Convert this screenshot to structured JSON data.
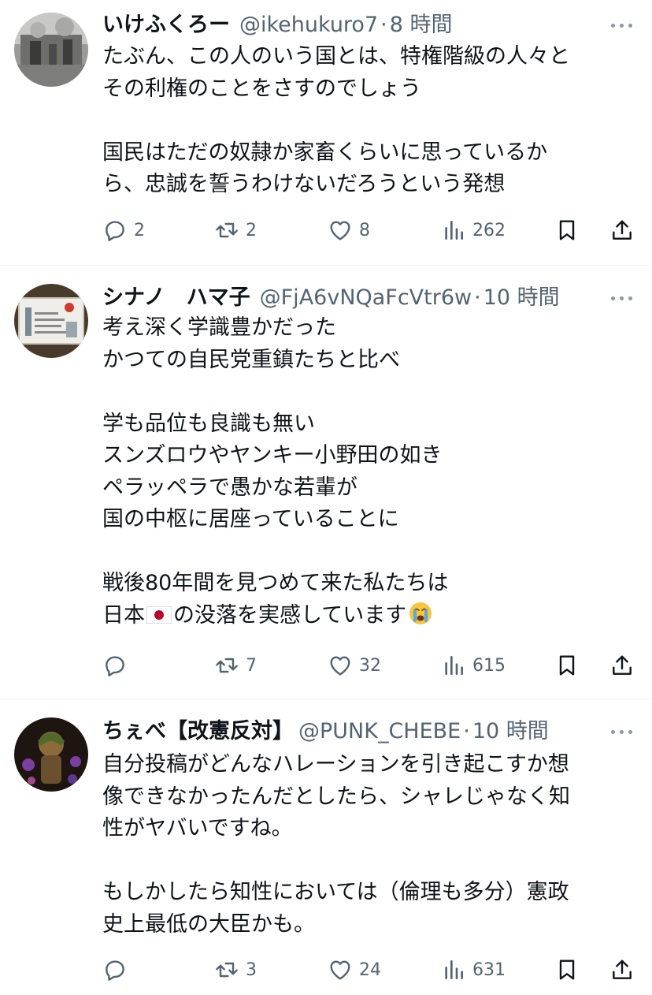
{
  "posts": [
    {
      "name": "いけふくろー",
      "handle": "@ikehukuro7",
      "separator": "·",
      "time": "8 時間",
      "lines": [
        "たぶん、この人のいう国とは、特権階級の人々と",
        "その利権のことをさすのでしょう",
        "",
        "国民はただの奴隷か家畜くらいに思っているか",
        "ら、忠誠を誓うわけないだろうという発想"
      ],
      "replies": "2",
      "reposts": "2",
      "likes": "8",
      "views": "262"
    },
    {
      "name": "シナノ　ハマ子",
      "handle": "@FjA6vNQaFcVtr6w",
      "separator": "·",
      "time": "10 時間",
      "lines": [
        "考え深く学識豊かだった",
        "かつての自民党重鎮たちと比べ",
        "",
        "学も品位も良識も無い",
        "スンズロウやヤンキー小野田の如き",
        "ペラッペラで愚かな若輩が",
        "国の中枢に居座っていることに",
        "",
        "戦後80年間を見つめて来た私たちは"
      ],
      "last_line_pre": "日本",
      "last_line_post": "の没落を実感しています",
      "replies": "",
      "reposts": "7",
      "likes": "32",
      "views": "615"
    },
    {
      "name": "ちぇべ【改憲反対】",
      "handle": "@PUNK_CHEBE",
      "separator": "·",
      "time": "10 時間",
      "lines": [
        "自分投稿がどんなハレーションを引き起こすか想",
        "像できなかったんだとしたら、シャレじゃなく知",
        "性がヤバいですね。",
        "",
        "もしかしたら知性においては（倫理も多分）憲政",
        "史上最低の大臣かも。"
      ],
      "replies": "",
      "reposts": "3",
      "likes": "24",
      "views": "631"
    }
  ],
  "icons": {
    "reply": "reply-icon",
    "repost": "repost-icon",
    "like": "heart-icon",
    "views": "views-icon",
    "bookmark": "bookmark-icon",
    "share": "share-icon",
    "more": "more-icon"
  },
  "colors": {
    "text": "#0f1419",
    "secondary": "#536471",
    "divider": "#eff3f4"
  }
}
